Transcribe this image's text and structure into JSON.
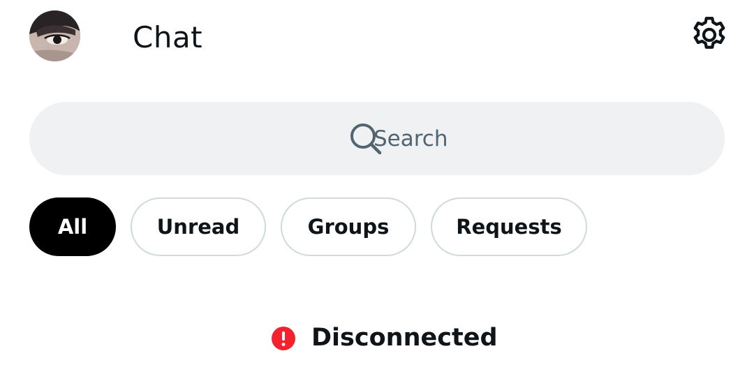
{
  "header": {
    "title": "Chat",
    "avatar_icon": "user-avatar",
    "settings_icon": "gear-icon"
  },
  "search": {
    "placeholder": "Search",
    "icon": "search-icon"
  },
  "filters": [
    {
      "label": "All",
      "active": true
    },
    {
      "label": "Unread",
      "active": false
    },
    {
      "label": "Groups",
      "active": false
    },
    {
      "label": "Requests",
      "active": false
    }
  ],
  "status": {
    "text": "Disconnected",
    "icon": "alert-icon",
    "color": "#f4212e"
  },
  "colors": {
    "chip_active_bg": "#000000",
    "chip_border": "#cfd9de",
    "search_bg": "#eff1f2",
    "muted_text": "#536471"
  }
}
